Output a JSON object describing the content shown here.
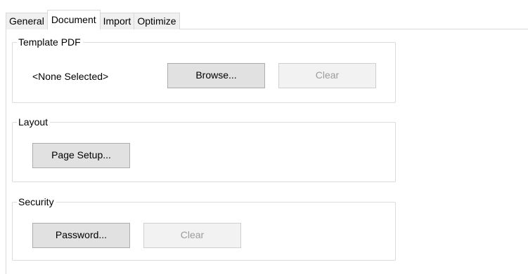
{
  "tabs": [
    {
      "label": "General"
    },
    {
      "label": "Document"
    },
    {
      "label": "Import"
    },
    {
      "label": "Optimize"
    }
  ],
  "active_tab": "Document",
  "template_pdf": {
    "title": "Template PDF",
    "selection": "<None Selected>",
    "browse_label": "Browse...",
    "clear_label": "Clear"
  },
  "layout": {
    "title": "Layout",
    "page_setup_label": "Page Setup..."
  },
  "security": {
    "title": "Security",
    "password_label": "Password...",
    "clear_label": "Clear"
  }
}
